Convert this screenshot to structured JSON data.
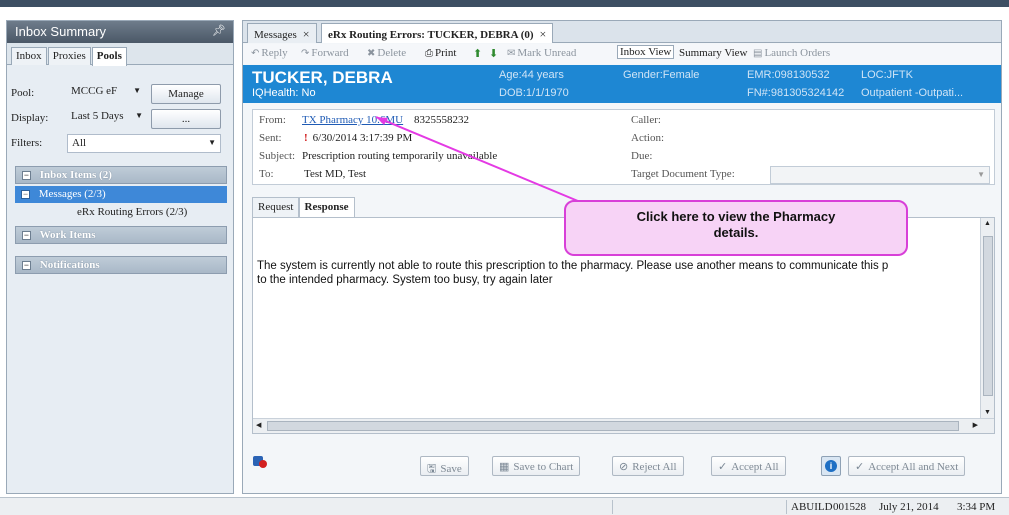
{
  "left_pane": {
    "title": "Inbox Summary",
    "pin_icon": "pin-icon",
    "tabs": [
      "Inbox",
      "Proxies",
      "Pools"
    ],
    "active_tab": "Pools",
    "pool_label": "Pool:",
    "pool_value": "MCCG eF",
    "manage_button": "Manage",
    "display_label": "Display:",
    "display_value": "Last 5 Days",
    "ellipsis_button": "...",
    "filters_label": "Filters:",
    "filters_value": "All",
    "sections": {
      "inbox_items": "Inbox Items (2)",
      "messages": "Messages (2/3)",
      "erx_routing": "eRx Routing Errors (2/3)",
      "work_items": "Work Items",
      "notifications": "Notifications"
    }
  },
  "right_pane": {
    "tabs": [
      {
        "label": "Messages",
        "close": "×"
      },
      {
        "label": "eRx Routing Errors: TUCKER, DEBRA (0)",
        "close": "×"
      }
    ],
    "toolbar": {
      "reply": "Reply",
      "forward": "Forward",
      "delete": "Delete",
      "print": "Print",
      "mark_unread": "Mark Unread",
      "inbox_view": "Inbox View",
      "summary_view": "Summary View",
      "launch_orders": "Launch Orders"
    },
    "banner": {
      "name": "TUCKER, DEBRA",
      "iqhealth": "IQHealth: No",
      "age": "Age:44 years",
      "dob": "DOB:1/1/1970",
      "gender": "Gender:Female",
      "emr": "EMR:098130532",
      "fin": "FN#:981305324142",
      "loc": "LOC:JFTK",
      "encounter": "Outpatient -Outpati..."
    },
    "header": {
      "from_label": "From:",
      "from_link": "TX Pharmacy 10.6MU",
      "from_phone": "8325558232",
      "sent_label": "Sent:",
      "sent_value": "6/30/2014 3:17:39 PM",
      "subject_label": "Subject:",
      "subject_value": "Prescription routing temporarily unavailable",
      "to_label": "To:",
      "to_value": "Test MD, Test",
      "caller_label": "Caller:",
      "action_label": "Action:",
      "due_label": "Due:",
      "target_label": "Target Document Type:"
    },
    "response_tabs": [
      "Request",
      "Response"
    ],
    "active_response_tab": "Response",
    "response_lines": [
      "The system is currently not able to route this prescription to the pharmacy.  Please use another means to communicate this p",
      "to the intended pharmacy. System too busy, try again later"
    ],
    "footer": {
      "save": "Save",
      "save_to_chart": "Save to Chart",
      "reject_all": "Reject All",
      "accept_all": "Accept All",
      "accept_all_next": "Accept All and Next"
    }
  },
  "callout": {
    "line1": "Click here to view the Pharmacy",
    "line2": "details.",
    "border_color": "#d83fd8",
    "fill_color": "#f7d3f6"
  },
  "status_bar": {
    "user": "ABUILD",
    "code": "001528",
    "date": "July 21, 2014",
    "time": "3:34 PM"
  },
  "colors": {
    "banner": "#1e87d3",
    "selection": "#3e88d8",
    "title_bar": "#5d6a78"
  }
}
